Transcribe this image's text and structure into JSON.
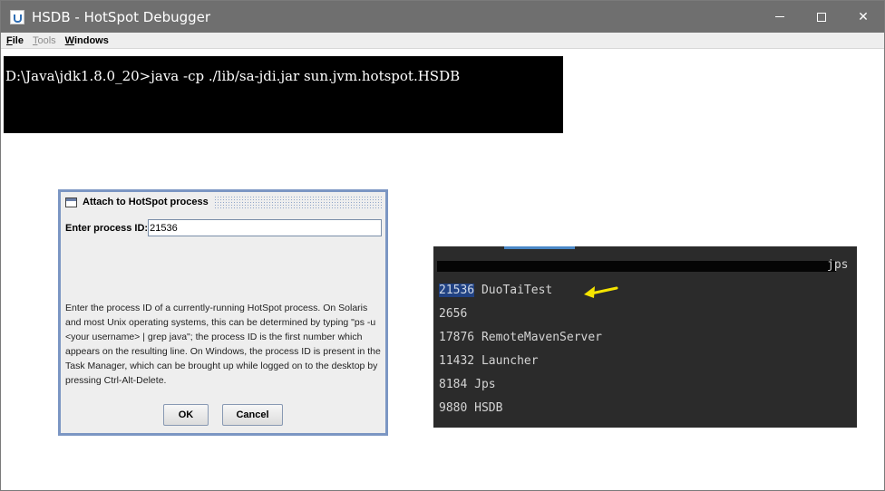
{
  "window": {
    "title": "HSDB - HotSpot Debugger",
    "controls": {
      "minimize": "—",
      "maximize": "□",
      "close": "✕"
    }
  },
  "menu": [
    {
      "mn": "F",
      "rest": "ile"
    },
    {
      "mn": "T",
      "rest": "ools"
    },
    {
      "mn": "W",
      "rest": "indows"
    }
  ],
  "console": {
    "command": "D:\\Java\\jdk1.8.0_20>java -cp ./lib/sa-jdi.jar sun.jvm.hotspot.HSDB"
  },
  "dialog": {
    "title": "Attach to HotSpot process",
    "pid_label": "Enter process ID:",
    "pid_value": "21536",
    "help_text": "Enter the process ID of a currently-running HotSpot process. On Solaris and most Unix operating systems, this can be determined by typing \"ps -u <your username> | grep java\"; the process ID is the first number which appears on the resulting line. On Windows, the process ID is present in the Task Manager, which can be brought up while logged on to the desktop by pressing Ctrl-Alt-Delete.",
    "ok_label": "OK",
    "cancel_label": "Cancel"
  },
  "terminal": {
    "command_suffix": "jps",
    "highlight_pid": "21536",
    "highlight_name": " DuoTaiTest",
    "lines": [
      "2656",
      "17876 RemoteMavenServer",
      "11432 Launcher",
      "8184 Jps",
      "9880 HSDB"
    ],
    "arrow_color": "#f5e400"
  }
}
